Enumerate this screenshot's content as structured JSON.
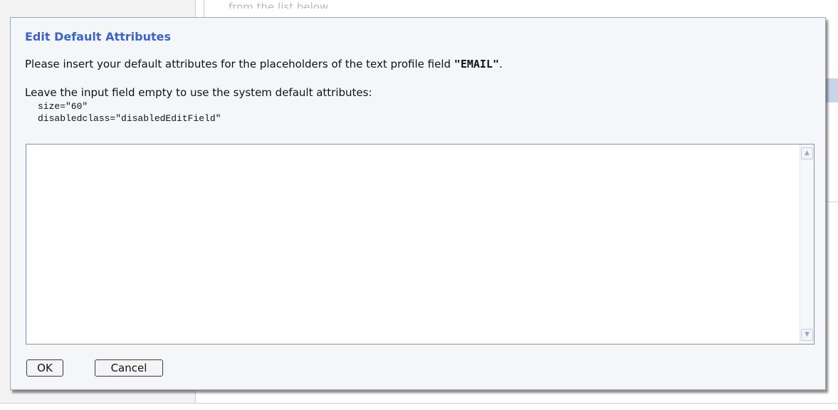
{
  "background": {
    "hint_text": "from the list below"
  },
  "dialog": {
    "title": "Edit Default Attributes",
    "intro_prefix": "Please insert your default attributes for the placeholders of the text profile field ",
    "field_name": "\"EMAIL\"",
    "intro_suffix": ".",
    "leave_empty_text": "Leave the input field empty to use the system default attributes:",
    "default_attributes": [
      "size=\"60\"",
      "disabledclass=\"disabledEditField\""
    ],
    "textarea_value": "",
    "ok_label": "OK",
    "cancel_label": "Cancel"
  },
  "icons": {
    "scroll_up": "scroll-up-arrow-icon",
    "scroll_down": "scroll-down-arrow-icon"
  },
  "colors": {
    "title": "#3a64c8",
    "dialog_bg": "#f4f6fa",
    "border": "#7f93b3"
  }
}
